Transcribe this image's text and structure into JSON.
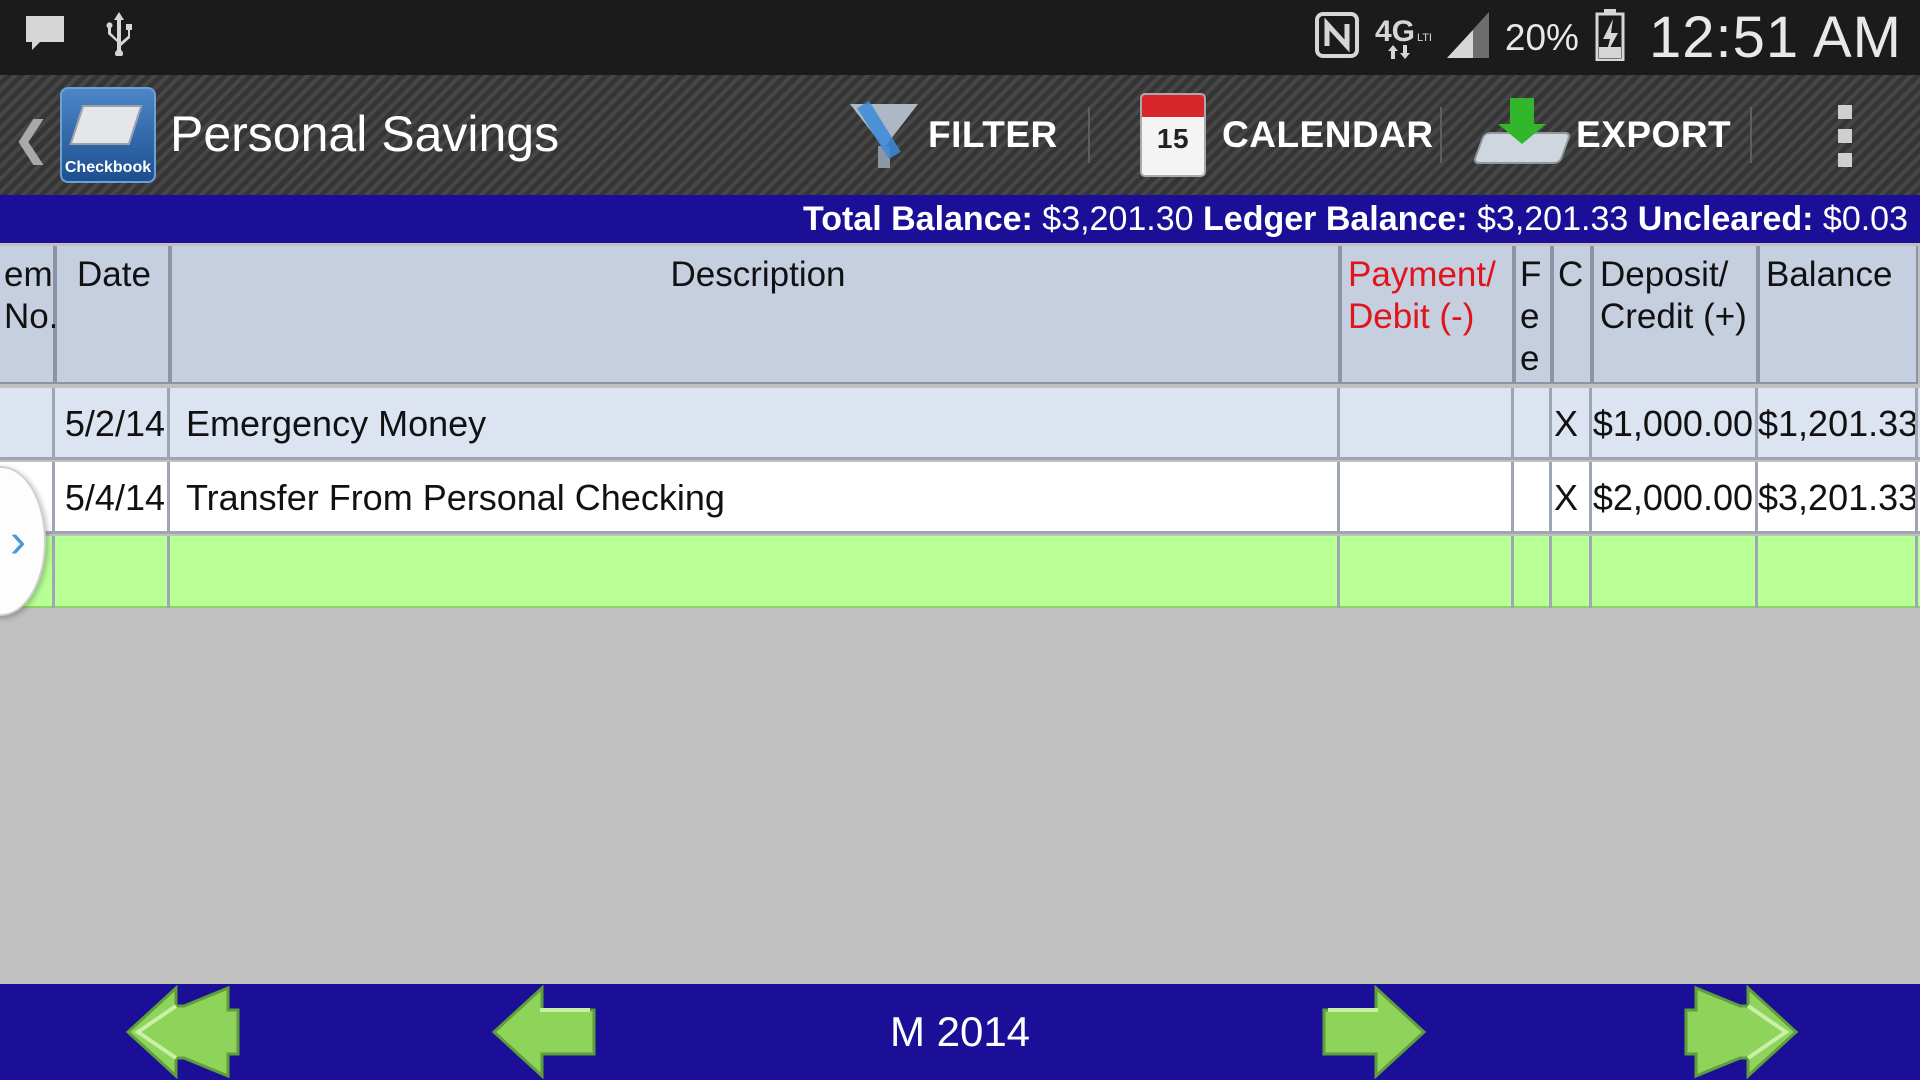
{
  "status_bar": {
    "battery_percent": "20%",
    "time": "12:51 AM",
    "icons": [
      "chat-icon",
      "usb-icon",
      "nfc-icon",
      "4g-lte-icon",
      "signal-icon",
      "battery-charging-icon"
    ]
  },
  "action_bar": {
    "app_icon_label": "Checkbook",
    "title": "Personal Savings",
    "filter_label": "FILTER",
    "calendar_label": "CALENDAR",
    "calendar_day": "15",
    "export_label": "EXPORT"
  },
  "balance": {
    "total_label": "Total Balance:",
    "total_value": "$3,201.30",
    "ledger_label": "Ledger Balance:",
    "ledger_value": "$3,201.33",
    "uncleared_label": "Uncleared:",
    "uncleared_value": "$0.03"
  },
  "table": {
    "headers": {
      "item_line1": "em",
      "item_line2": "No.",
      "date": "Date",
      "description": "Description",
      "payment_line1": "Payment/",
      "payment_line2": "Debit (-)",
      "fee_line1": "F",
      "fee_line2": "e",
      "fee_line3": "e",
      "cleared": "C",
      "deposit_line1": "Deposit/",
      "deposit_line2": "Credit (+)",
      "balance": "Balance"
    },
    "rows": [
      {
        "item": "",
        "date": "5/2/14",
        "description": "Emergency Money",
        "payment": "",
        "fee": "",
        "cleared": "X",
        "deposit": "$1,000.00",
        "balance": "$1,201.33"
      },
      {
        "item": "",
        "date": "5/4/14",
        "description": "Transfer From Personal Checking",
        "payment": "",
        "fee": "",
        "cleared": "X",
        "deposit": "$2,000.00",
        "balance": "$3,201.33"
      },
      {
        "item": "",
        "date": "",
        "description": "",
        "payment": "",
        "fee": "",
        "cleared": "",
        "deposit": "",
        "balance": ""
      }
    ],
    "row_colors": [
      "#dce4f2",
      "#ffffff",
      "#b8ff94"
    ]
  },
  "bottom_bar": {
    "period_label": "M 2014"
  },
  "colors": {
    "accent_blue": "#1a0f96",
    "debit_red": "#e0151b",
    "new_row_green": "#b8ff94",
    "nav_arrow_green": "#8ed35a"
  }
}
